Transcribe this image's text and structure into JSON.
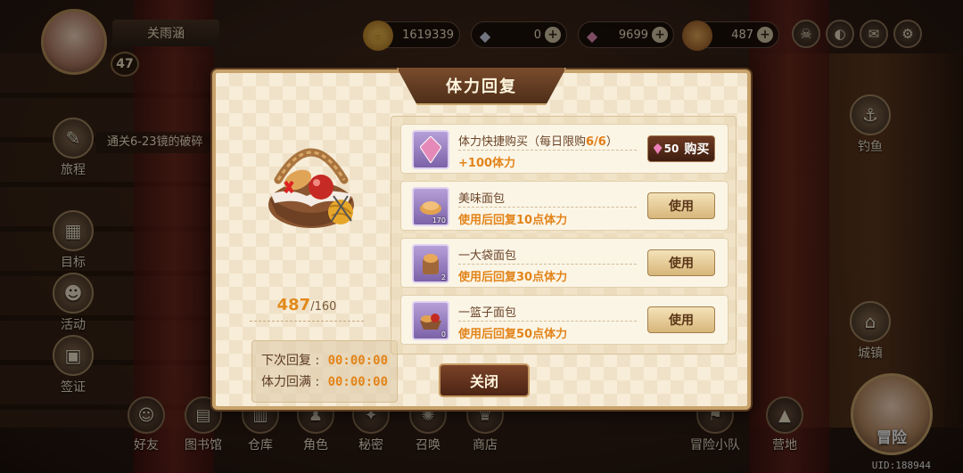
{
  "player": {
    "name": "关雨涵",
    "level": "47"
  },
  "currencies": [
    {
      "icon": "gold-coin-icon",
      "glyph": "◉",
      "value": "1619339",
      "color": "#d8a23a",
      "plus": false
    },
    {
      "icon": "diamond-icon",
      "glyph": "◆",
      "value": "0",
      "color": "#cfd6e8",
      "plus": true
    },
    {
      "icon": "crystal-icon",
      "glyph": "◆",
      "value": "9699",
      "color": "#e48ab4",
      "plus": true
    },
    {
      "icon": "bread-icon",
      "glyph": "●",
      "value": "487",
      "color": "#c98a42",
      "plus": true
    }
  ],
  "top_icons": [
    "skull-icon",
    "ear-icon",
    "mail-icon",
    "gear-icon"
  ],
  "left_nav": {
    "quest_text": "通关6-23镜的破碎",
    "journey": "旅程",
    "goals": "目标",
    "events": "活动",
    "sign_in": "签证"
  },
  "right_nav": {
    "fishing": "钓鱼",
    "town": "城镇"
  },
  "bottom_nav": [
    "好友",
    "图书馆",
    "仓库",
    "角色",
    "秘密",
    "召唤",
    "商店",
    "冒险小队",
    "营地"
  ],
  "adventure_label": "冒险",
  "uid": "UID:188944",
  "modal": {
    "title": "体力回复",
    "stamina_current": "487",
    "stamina_max": "/160",
    "next_recover_label": "下次回复 :",
    "next_recover_time": "00:00:00",
    "full_recover_label": "体力回满 :",
    "full_recover_time": "00:00:00",
    "close_label": "关闭",
    "items": [
      {
        "name": "体力快捷购买（每日限购",
        "limit": "6/6",
        "name_suffix": "）",
        "desc": "+100体力",
        "qty": "",
        "action": "购买",
        "cost": "50"
      },
      {
        "name": "美味面包",
        "desc": "使用后回复10点体力",
        "qty": "170",
        "action": "使用"
      },
      {
        "name": "一大袋面包",
        "desc": "使用后回复30点体力",
        "qty": "2",
        "action": "使用"
      },
      {
        "name": "一篮子面包",
        "desc": "使用后回复50点体力",
        "qty": "0",
        "action": "使用"
      }
    ]
  }
}
